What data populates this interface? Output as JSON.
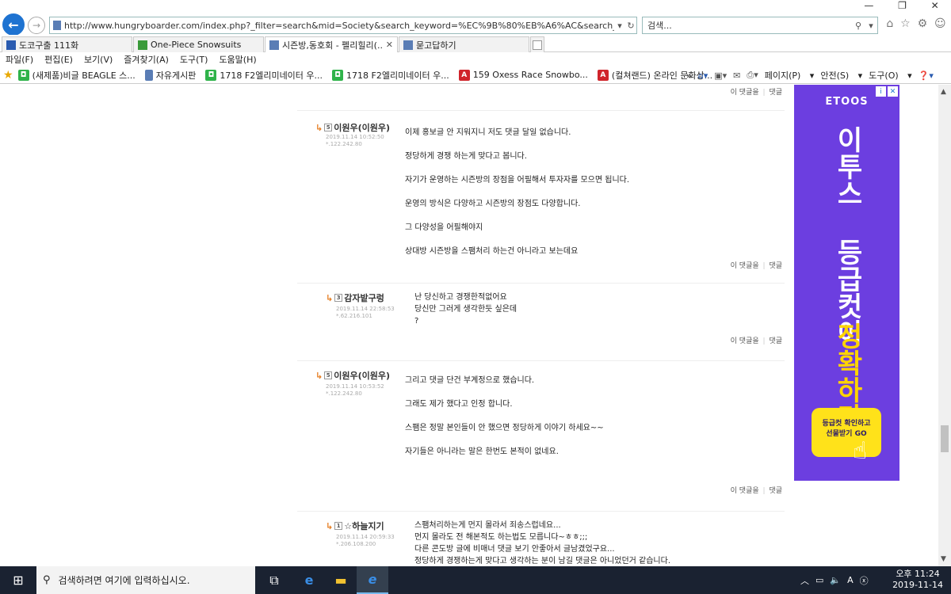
{
  "browser": {
    "url": "http://www.hungryboarder.com/index.php?_filter=search&mid=Society&search_keyword=%EC%9B%80%EB%A6%AC&search_target=title_content&docum",
    "search_placeholder": "검색...",
    "tabs": [
      {
        "label": "도코구출 111화",
        "icon": "snowboard-icon"
      },
      {
        "label": "One-Piece Snowsuits",
        "icon": "mountain-icon"
      },
      {
        "label": "시즌방,동호회 - 펠리힐리(...",
        "icon": "page-icon"
      },
      {
        "label": "묻고답하기",
        "icon": "page-icon"
      }
    ],
    "menu": [
      "파일(F)",
      "편집(E)",
      "보기(V)",
      "즐겨찾기(A)",
      "도구(T)",
      "도움말(H)"
    ],
    "favorites": [
      {
        "label": "(새제품)비글 BEAGLE 스...",
        "icon": "green-shop-icon"
      },
      {
        "label": "자유게시판",
        "icon": "page-icon"
      },
      {
        "label": "1718 F2엘리미네이터 우...",
        "icon": "green-shop-icon"
      },
      {
        "label": "1718 F2엘리미네이터 우...",
        "icon": "green-shop-icon"
      },
      {
        "label": "159 Oxess Race Snowbo...",
        "icon": "red-a-icon"
      },
      {
        "label": "(컬쳐랜드) 온라인 문화상...",
        "icon": "red-a-icon"
      }
    ],
    "commands": [
      "페이지(P)",
      "안전(S)",
      "도구(O)"
    ],
    "overflow": "»"
  },
  "comments": [
    {
      "author": "이원우(이원우)",
      "level": "5",
      "date": "2019.11.14 10:52:50",
      "ip": "*.122.242.80",
      "lines": [
        "이제 홍보글 안 지워지니 저도 댓글 달일 없습니다.",
        "정당하게 경쟁 하는게 맞다고 봅니다.",
        "자기가 운영하는 시즌방의 장점을 어필해서  투자자를 모으면 됩니다.",
        "운영의 방식은 다양하고  시즌방의 장점도 다양합니다.",
        "그 다양성을 어필해야지",
        "상대방 시즌방을 스팸처리 하는건 아니라고 보는데요"
      ]
    },
    {
      "author": "감자밭구렁",
      "level": "3",
      "date": "2019.11.14 22:58:53",
      "ip": "*.62.216.101",
      "lines": [
        "난 당신하고 경쟁한적없어요",
        "당신만 그러게 생각한듯 싶은데",
        "?"
      ]
    },
    {
      "author": "이원우(이원우)",
      "level": "5",
      "date": "2019.11.14 10:53:52",
      "ip": "*.122.242.80",
      "lines": [
        "그리고 댓글 단건 부계정으로 했습니다.",
        "그래도 제가 했다고 인정 합니다.",
        "스팸은 정말 본인들이 안 했으면 정당하게 이야기 하세요~~",
        "자기들은 아니라는 말은 한번도 본적이 없네요."
      ]
    },
    {
      "author": "☆하늘지기",
      "level": "1",
      "date": "2019.11.14 20:59:33",
      "ip": "*.206.108.200",
      "lines": [
        "스팸처리하는게 먼지 몰라서 죄송스럽네요...",
        "먼지 몰라도 전 해본적도 하는법도 모릅니다~ㅎㅎ;;;",
        "다른 콘도방 글에 비매너 댓글 보기 안좋아서 글남겼었구요...",
        "정당하게 경쟁하는게 맞다고 생각하는 분이 남길 댓글은 아니었던거 같습니다."
      ]
    }
  ],
  "actions": {
    "reply_this": "이 댓글을",
    "separator": "|",
    "reply": "댓글"
  },
  "ad": {
    "brand": "ETOOS",
    "line1": "이투스 등급컷이",
    "line2": "정확하다",
    "cta1": "등급컷 확인하고",
    "cta2": "선물받기 GO"
  },
  "taskbar": {
    "search_placeholder": "검색하려면 여기에 입력하십시오.",
    "time": "오후 11:24",
    "date": "2019-11-14"
  },
  "colors": {
    "accent": "#1e73d1",
    "ad_bg": "#6c3ee0",
    "ad_highlight": "#ffd400",
    "taskbar": "#1a2231",
    "arrow": "#e67e22"
  }
}
